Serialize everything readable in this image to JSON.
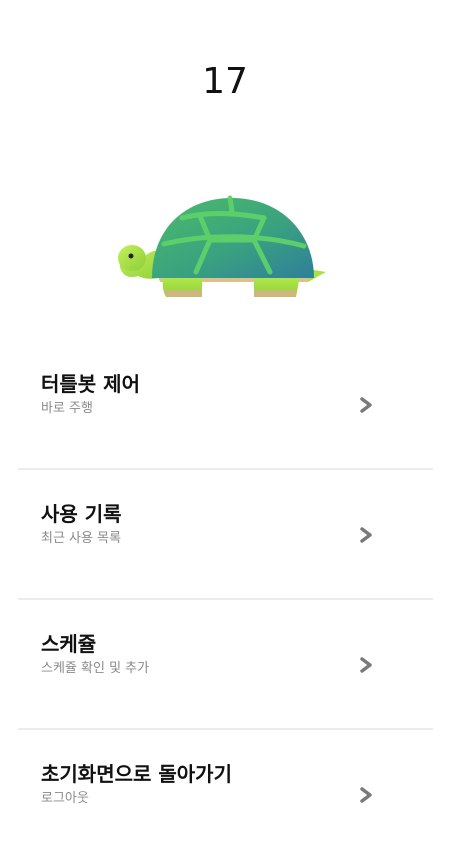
{
  "header": {
    "number": "17"
  },
  "mascot": {
    "icon": "turtle-icon",
    "shell_color": "#3aa27f",
    "body_color": "#a9e44a"
  },
  "menu": {
    "items": [
      {
        "title": "터틀봇 제어",
        "subtitle": "바로 주행",
        "icon": "chevron-right-icon"
      },
      {
        "title": "사용 기록",
        "subtitle": "최근 사용 목록",
        "icon": "chevron-right-icon"
      },
      {
        "title": "스케쥴",
        "subtitle": "스케쥴 확인 및 추가",
        "icon": "chevron-right-icon"
      },
      {
        "title": "초기화면으로 돌아가기",
        "subtitle": "로그아웃",
        "icon": "chevron-right-icon"
      }
    ]
  },
  "colors": {
    "divider": "#ececec",
    "chevron": "#7a7a7a",
    "subtitle": "#8a8a8a"
  }
}
